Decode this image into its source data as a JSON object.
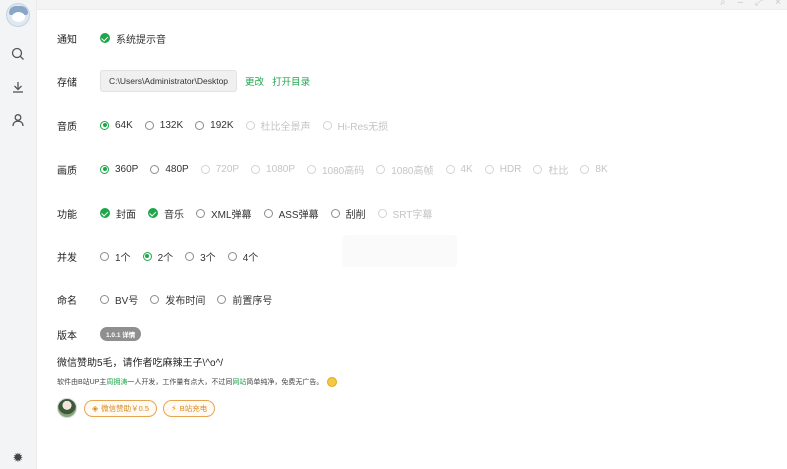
{
  "window_controls": [
    "⌕",
    "–",
    "⤢",
    "×"
  ],
  "sidebar": {
    "items": [
      {
        "name": "search-icon",
        "glyph": "⌕"
      },
      {
        "name": "download-icon",
        "glyph": "⤓"
      },
      {
        "name": "user-icon",
        "glyph": "⚇"
      }
    ],
    "settings_glyph": "✹"
  },
  "settings": {
    "notify": {
      "label": "通知",
      "option": "系统提示音"
    },
    "storage": {
      "label": "存储",
      "path": "C:\\Users\\Administrator\\Desktop",
      "change": "更改",
      "open": "打开目录"
    },
    "audio": {
      "label": "音质",
      "options": [
        "64K",
        "132K",
        "192K",
        "杜比全景声",
        "Hi-Res无损"
      ]
    },
    "video": {
      "label": "画质",
      "options": [
        "360P",
        "480P",
        "720P",
        "1080P",
        "1080高码",
        "1080高帧",
        "4K",
        "HDR",
        "杜比",
        "8K"
      ]
    },
    "features": {
      "label": "功能",
      "options": [
        "封面",
        "音乐",
        "XML弹幕",
        "ASS弹幕",
        "刮削",
        "SRT字幕"
      ]
    },
    "concurrency": {
      "label": "并发",
      "options": [
        "1个",
        "2个",
        "3个",
        "4个"
      ]
    },
    "naming": {
      "label": "命名",
      "options": [
        "BV号",
        "发布时间",
        "前置序号"
      ]
    },
    "version": {
      "label": "版本",
      "value": "1.0.1 详情"
    }
  },
  "donate": {
    "title": "微信赞助5毛，请作者吃麻辣王子\\^o^/",
    "desc_prefix": "软件由B站UP主",
    "author": "周拥涛",
    "desc_mid": "一人开发，工作量有点大，不过同",
    "site": "网站",
    "desc_suffix": "简单纯净，免费无广告。",
    "wechat_btn": "微信赞助￥0.5",
    "charge_btn": "B站充电"
  },
  "colors": {
    "accent": "#1ea64a",
    "pill": "#d98a1f"
  }
}
